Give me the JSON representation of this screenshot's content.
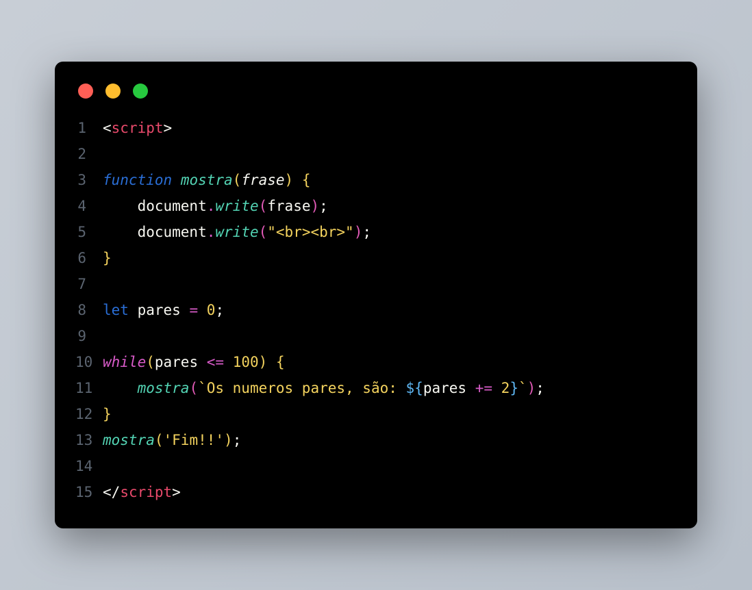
{
  "window": {
    "traffic_lights": {
      "red": "#ff5f56",
      "yellow": "#ffbd2e",
      "green": "#27c93f"
    }
  },
  "code": {
    "lines": [
      {
        "num": "1"
      },
      {
        "num": "2"
      },
      {
        "num": "3"
      },
      {
        "num": "4"
      },
      {
        "num": "5"
      },
      {
        "num": "6"
      },
      {
        "num": "7"
      },
      {
        "num": "8"
      },
      {
        "num": "9"
      },
      {
        "num": "10"
      },
      {
        "num": "11"
      },
      {
        "num": "12"
      },
      {
        "num": "13"
      },
      {
        "num": "14"
      },
      {
        "num": "15"
      }
    ],
    "tokens": {
      "lt": "<",
      "gt": ">",
      "slash": "/",
      "script_tag": "script",
      "function_kw": "function",
      "mostra_fn": "mostra",
      "frase_param": "frase",
      "document_obj": "document",
      "write_method": "write",
      "br_string": "\"<br><br>\"",
      "let_kw": "let",
      "pares_var": "pares",
      "equals": "=",
      "zero": "0",
      "while_kw": "while",
      "lte": "<=",
      "hundred": "100",
      "template_start": "`Os numeros pares, são: ",
      "dollar_brace": "${",
      "plus_equals": "+=",
      "two": "2",
      "close_brace": "}",
      "backtick": "`",
      "fim_string": "'Fim!!'",
      "semicolon": ";",
      "open_paren": "(",
      "close_paren": ")",
      "open_brace": "{",
      "close_brace_plain": "}",
      "dot": ".",
      "space4": "    "
    }
  }
}
